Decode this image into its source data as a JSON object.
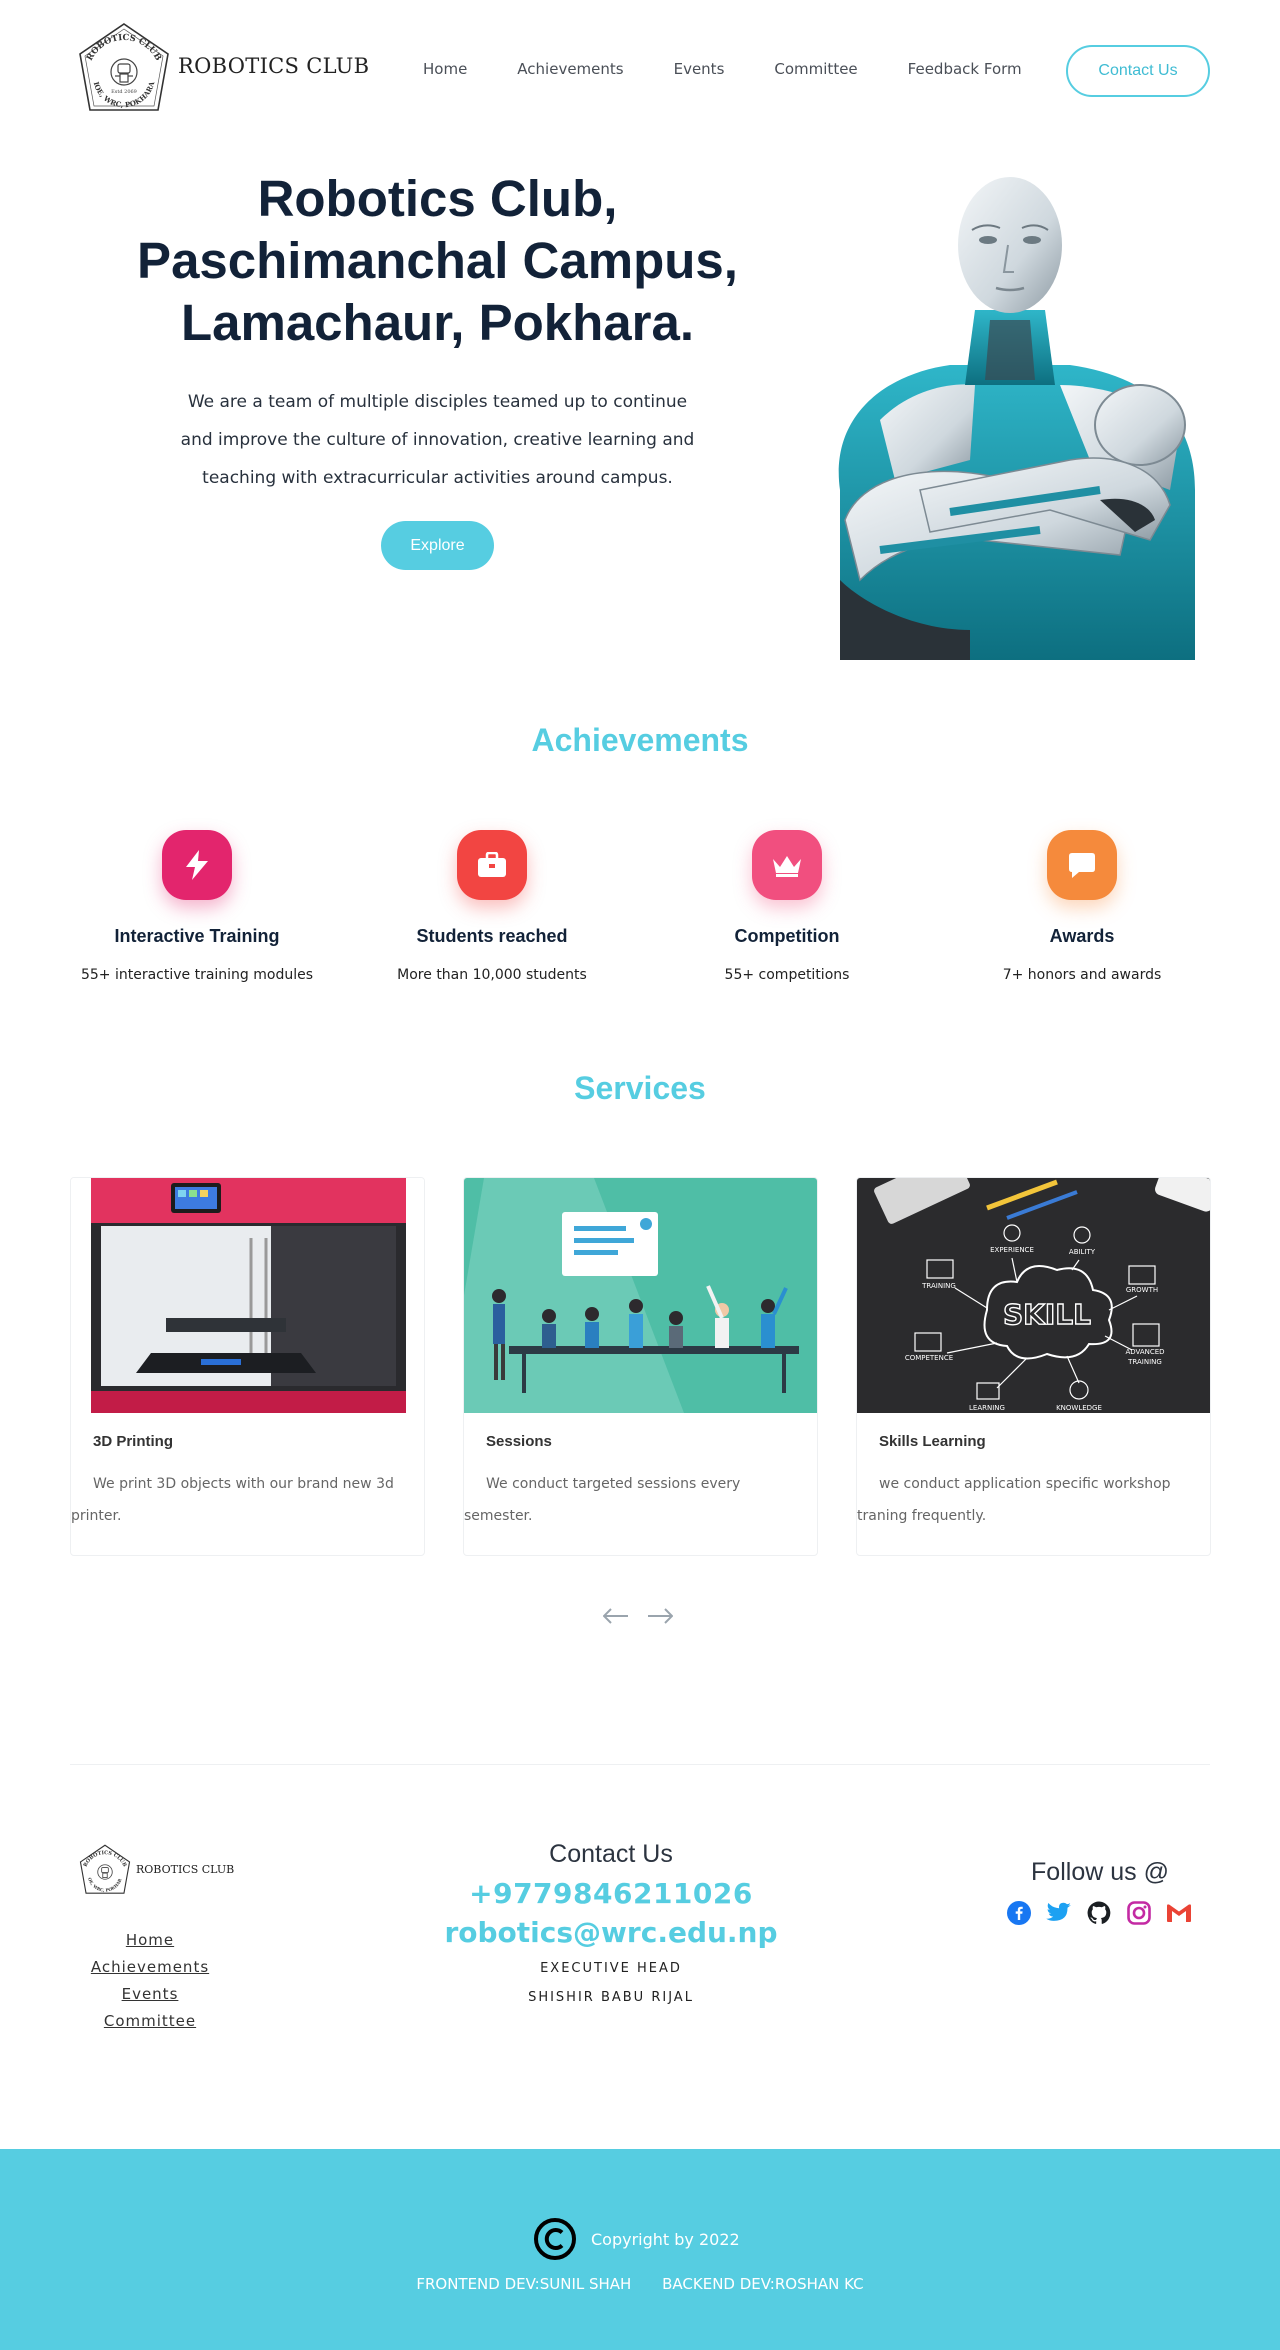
{
  "brand": {
    "name": "ROBOTICS CLUB",
    "seal_top_text": "ROBOTICS CLUB",
    "seal_bottom_text": "IOE, WRC, POKHARA",
    "seal_estd": "Estd 2069"
  },
  "nav": {
    "links": [
      "Home",
      "Achievements",
      "Events",
      "Committee",
      "Feedback Form"
    ],
    "contact_label": "Contact Us"
  },
  "hero": {
    "title_lines": [
      "Robotics Club,",
      "Paschimanchal Campus,",
      "Lamachaur, Pokhara."
    ],
    "desc_lines": [
      "We are a team of multiple disciples teamed up to continue",
      "and improve the culture of innovation, creative learning and",
      "teaching with extracurricular activities around campus."
    ],
    "explore_label": "Explore",
    "image_icon": "robot-illustration"
  },
  "achievements": {
    "title": "Achievements",
    "items": [
      {
        "icon": "bolt-icon",
        "name": "Interactive Training",
        "desc": "55+ interactive training modules",
        "color": "#e3256d"
      },
      {
        "icon": "briefcase-icon",
        "name": "Students reached",
        "desc": "More than 10,000 students",
        "color": "#f24542"
      },
      {
        "icon": "crown-icon",
        "name": "Competition",
        "desc": "55+ competitions",
        "color": "#f14f7f"
      },
      {
        "icon": "chat-icon",
        "name": "Awards",
        "desc": "7+ honors and awards",
        "color": "#f58a3c"
      }
    ]
  },
  "services": {
    "title": "Services",
    "items": [
      {
        "image_icon": "3d-printer-image",
        "name": "3D Printing",
        "desc": "We print 3D objects with our brand new 3d printer."
      },
      {
        "image_icon": "sessions-image",
        "name": "Sessions",
        "desc": "We conduct targeted sessions every semester."
      },
      {
        "image_icon": "skill-chalkboard-image",
        "name": "Skills Learning",
        "desc": "we conduct application specific workshop traning frequently."
      }
    ],
    "skill_board": {
      "center": "SKILL",
      "labels": [
        "EXPERIENCE",
        "ABILITY",
        "TRAINING",
        "GROWTH",
        "COMPETENCE",
        "ADVANCED",
        "TRAINING",
        "LEARNING",
        "KNOWLEDGE"
      ]
    }
  },
  "footer": {
    "links": [
      "Home",
      "Achievements",
      "Events",
      "Committee"
    ],
    "contact_heading": "Contact Us",
    "phone": "+9779846211026",
    "email": "robotics@wrc.edu.np",
    "role": "EXECUTIVE HEAD",
    "person": "SHISHIR BABU RIJAL",
    "follow_heading": "Follow us @",
    "socials": [
      "facebook-icon",
      "twitter-icon",
      "github-icon",
      "instagram-icon",
      "gmail-icon"
    ]
  },
  "bottom": {
    "copyright": "Copyright by 2022",
    "frontend": "FRONTEND DEV:SUNIL SHAH",
    "backend": "BACKEND DEV:ROSHAN KC"
  },
  "colors": {
    "accent": "#56cde1",
    "heading": "#122238"
  }
}
